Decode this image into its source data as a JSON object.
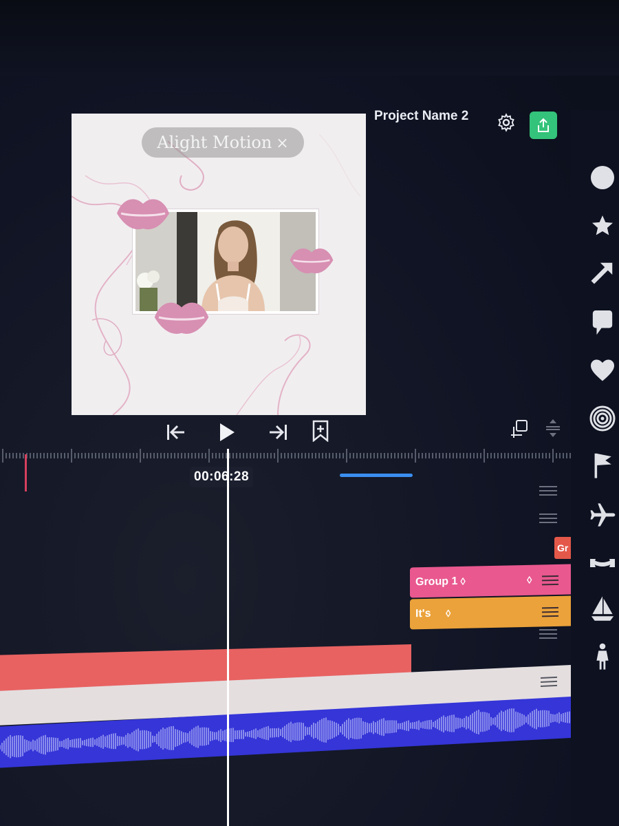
{
  "header": {
    "project_name": "Project Name 2",
    "export_color": "#34c37a"
  },
  "preview": {
    "watermark_text": "Alight Motion",
    "watermark_close": "×"
  },
  "timeline": {
    "timecode": "00:06:28",
    "layers": [
      {
        "name": "Gr",
        "color": "#e4584a"
      },
      {
        "name": "Group 1",
        "color": "#e9588f"
      },
      {
        "name": "It's",
        "color": "#eba23a"
      },
      {
        "name": "",
        "color": "#e86262"
      },
      {
        "name": "",
        "color": "#e4dedf"
      },
      {
        "name": "",
        "color": "#3535d8"
      }
    ]
  },
  "sidebar": {
    "shapes": [
      "circle-icon",
      "star-icon",
      "arrow-icon",
      "speech-bubble-icon",
      "heart-icon",
      "spiral-icon",
      "flag-icon",
      "airplane-icon",
      "ribbon-icon",
      "sailboat-icon",
      "person-icon"
    ]
  },
  "transport": {
    "controls": [
      "skip-to-start-icon",
      "play-icon",
      "skip-to-end-icon",
      "add-bookmark-icon",
      "duplicate-icon",
      "expand-icon"
    ]
  }
}
